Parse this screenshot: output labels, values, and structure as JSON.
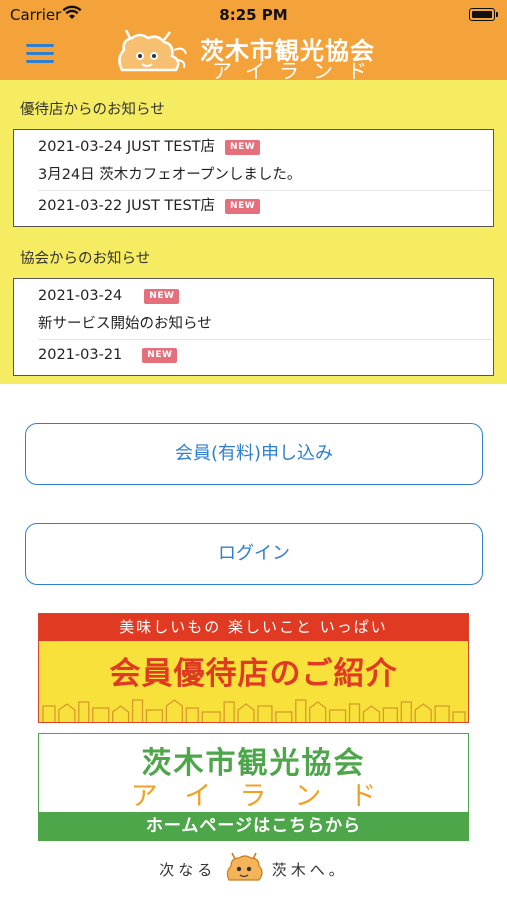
{
  "status_bar": {
    "carrier": "Carrier",
    "time": "8:25 PM"
  },
  "header": {
    "logo_title": "茨木市観光協会",
    "logo_sub": "アイランド"
  },
  "colors": {
    "header_bg": "#f4a23a",
    "notice_bg": "#f6ec62",
    "accent_blue": "#2f7fd1",
    "badge": "#e56f7a"
  },
  "shop_notices": {
    "title": "優待店からのお知らせ",
    "items": [
      {
        "meta": "2021-03-24  JUST TEST店",
        "badge": "NEW",
        "text": "3月24日 茨木カフェオープンしました。"
      },
      {
        "meta": "2021-03-22  JUST TEST店",
        "badge": "NEW"
      }
    ]
  },
  "assoc_notices": {
    "title": "協会からのお知らせ",
    "items": [
      {
        "meta": "2021-03-24",
        "badge": "NEW",
        "text": "新サービス開始のお知らせ"
      },
      {
        "meta": "2021-03-21",
        "badge": "NEW"
      }
    ]
  },
  "buttons": {
    "signup": "会員(有料)申し込み",
    "login": "ログイン"
  },
  "banner_shops": {
    "top": "美味しいもの 楽しいこと いっぱい",
    "main": "会員優待店のご紹介"
  },
  "banner_home": {
    "title": "茨木市観光協会",
    "sub": "アイランド",
    "bar": "ホームページはこちらから"
  },
  "footer": {
    "left": "次なる",
    "right": "茨木へ。"
  }
}
